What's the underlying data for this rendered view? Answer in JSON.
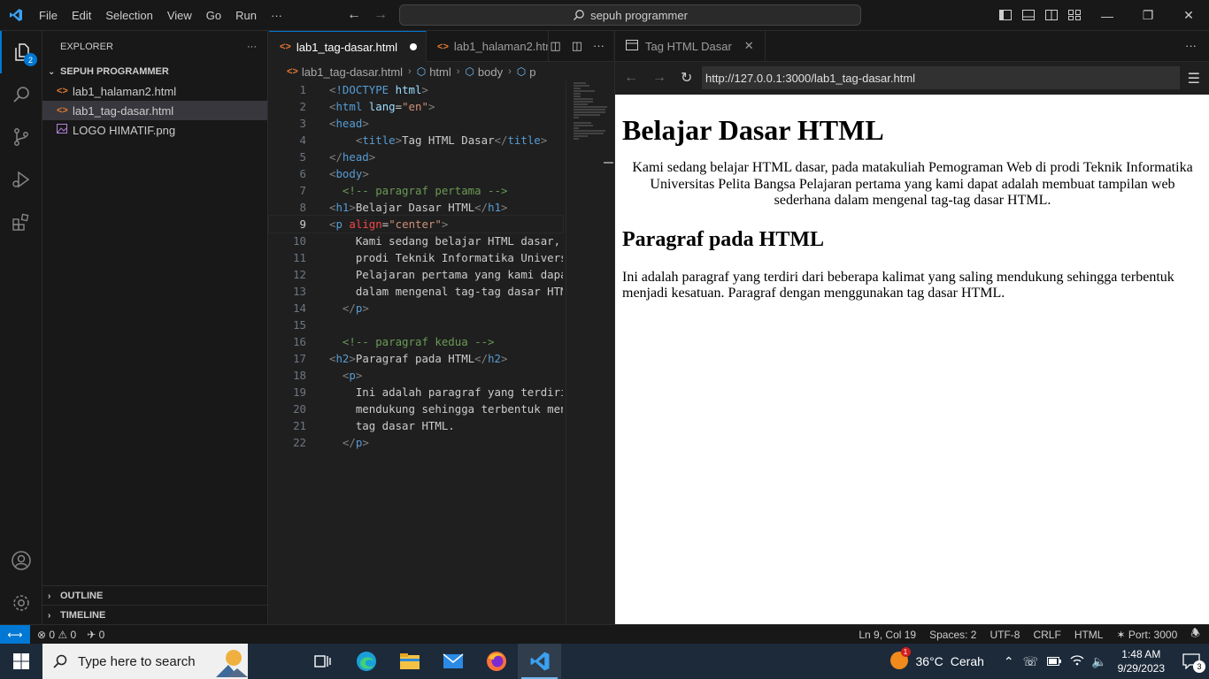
{
  "titlebar": {
    "menu": [
      "File",
      "Edit",
      "Selection",
      "View",
      "Go",
      "Run",
      "···"
    ],
    "command_center": "sepuh programmer"
  },
  "activity": {
    "explorer_badge": "2"
  },
  "sidebar": {
    "title": "EXPLORER",
    "more": "···",
    "folder": "SEPUH PROGRAMMER",
    "files": [
      {
        "name": "lab1_halaman2.html",
        "icon": "html-file-icon"
      },
      {
        "name": "lab1_tag-dasar.html",
        "icon": "html-file-icon"
      },
      {
        "name": "LOGO HIMATIF.png",
        "icon": "image-file-icon"
      }
    ],
    "outline": "OUTLINE",
    "timeline": "TIMELINE"
  },
  "editor": {
    "tabs": [
      {
        "label": "lab1_tag-dasar.html",
        "active": true,
        "dirty": true
      },
      {
        "label": "lab1_halaman2.html",
        "active": false
      }
    ],
    "breadcrumb": [
      "lab1_tag-dasar.html",
      "html",
      "body",
      "p"
    ],
    "current_line": 9
  },
  "preview": {
    "tab_label": "Tag HTML Dasar",
    "url": "http://127.0.0.1:3000/lab1_tag-dasar.html",
    "h1": "Belajar Dasar HTML",
    "p1": "Kami sedang belajar HTML dasar, pada matakuliah Pemograman Web di prodi Teknik Informatika Universitas Pelita Bangsa Pelajaran pertama yang kami dapat adalah membuat tampilan web sederhana dalam mengenal tag-tag dasar HTML.",
    "h2": "Paragraf pada HTML",
    "p2": "Ini adalah paragraf yang terdiri dari beberapa kalimat yang saling mendukung sehingga terbentuk menjadi kesatuan. Paragraf dengan menggunakan tag dasar HTML."
  },
  "statusbar": {
    "errors": "0",
    "warnings": "0",
    "ports": "0",
    "position": "Ln 9, Col 19",
    "spaces": "Spaces: 2",
    "encoding": "UTF-8",
    "eol": "CRLF",
    "language": "HTML",
    "port": "Port: 3000"
  },
  "taskbar": {
    "search_placeholder": "Type here to search",
    "weather_temp": "36°C",
    "weather_desc": "Cerah",
    "time": "1:48 AM",
    "date": "9/29/2023",
    "notification_count": "3"
  }
}
